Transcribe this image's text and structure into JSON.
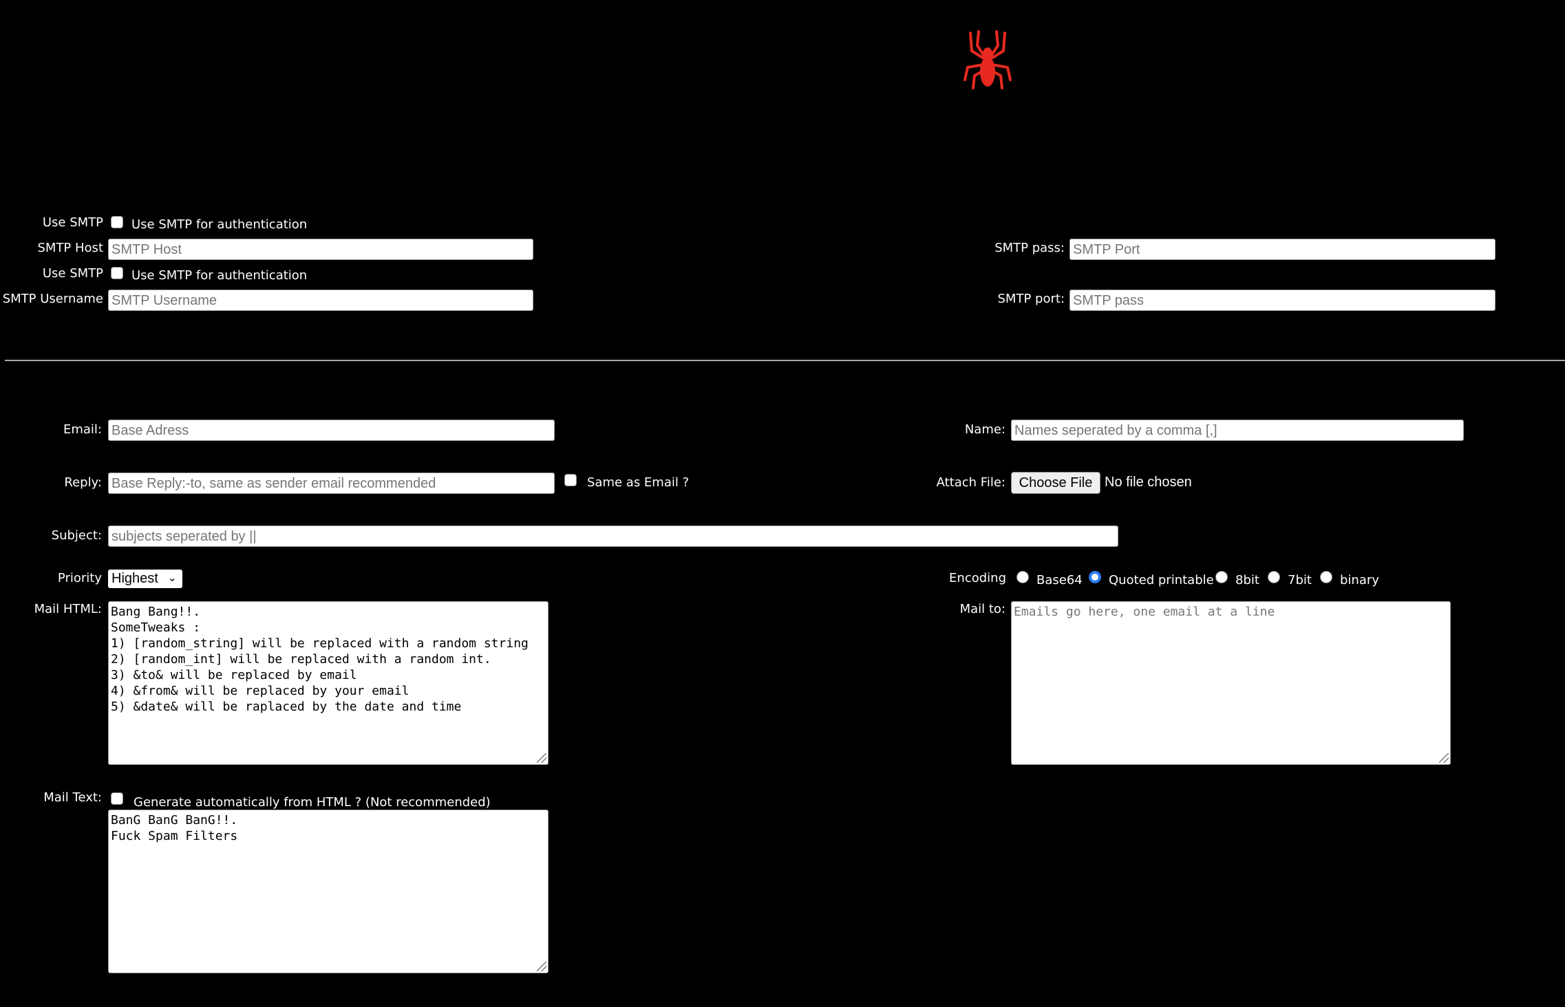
{
  "logo": {
    "icon": "spider-icon",
    "color": "#e8291f"
  },
  "smtp": {
    "use_smtp_label": "Use SMTP",
    "use_smtp_text": "Use SMTP for authentication",
    "host_label": "SMTP Host",
    "host_placeholder": "SMTP Host",
    "use_smtp_label_2": "Use SMTP",
    "use_smtp_text_2": "Use SMTP for authentication",
    "username_label": "SMTP Username",
    "username_placeholder": "SMTP Username",
    "pass_label": "SMTP pass:",
    "pass_placeholder": "SMTP Port",
    "port_label": "SMTP port:",
    "port_placeholder": "SMTP pass"
  },
  "form": {
    "email_label": "Email:",
    "email_placeholder": "Base Adress",
    "name_label": "Name:",
    "name_placeholder": "Names seperated by a comma [,]",
    "reply_label": "Reply:",
    "reply_placeholder": "Base Reply:-to, same as sender email recommended",
    "same_as_email": "Same as Email ?",
    "attach_label": "Attach File:",
    "choose_file": "Choose File",
    "no_file": "No file chosen",
    "subject_label": "Subject:",
    "subject_placeholder": "subjects seperated by ||",
    "priority_label": "Priority",
    "priority_value": "Highest",
    "encoding_label": "Encoding",
    "encodings": [
      "Base64",
      "Quoted printable",
      "8bit",
      "7bit",
      "binary"
    ],
    "encoding_selected": "Quoted printable",
    "mail_html_label": "Mail HTML:",
    "mail_html_value": "Bang Bang!!.\nSomeTweaks :\n1) [random_string] will be replaced with a random string\n2) [random_int] will be replaced with a random int.\n3) &to& will be replaced by email\n4) &from& will be replaced by your email\n5) &date& will be raplaced by the date and time",
    "mail_to_label": "Mail to:",
    "mail_to_placeholder": "Emails go here, one email at a line",
    "mail_text_label": "Mail Text:",
    "generate_auto": "Generate automatically from HTML ? (Not recommended)",
    "mail_text_value": "BanG BanG BanG!!.\nFuck Spam Filters"
  }
}
